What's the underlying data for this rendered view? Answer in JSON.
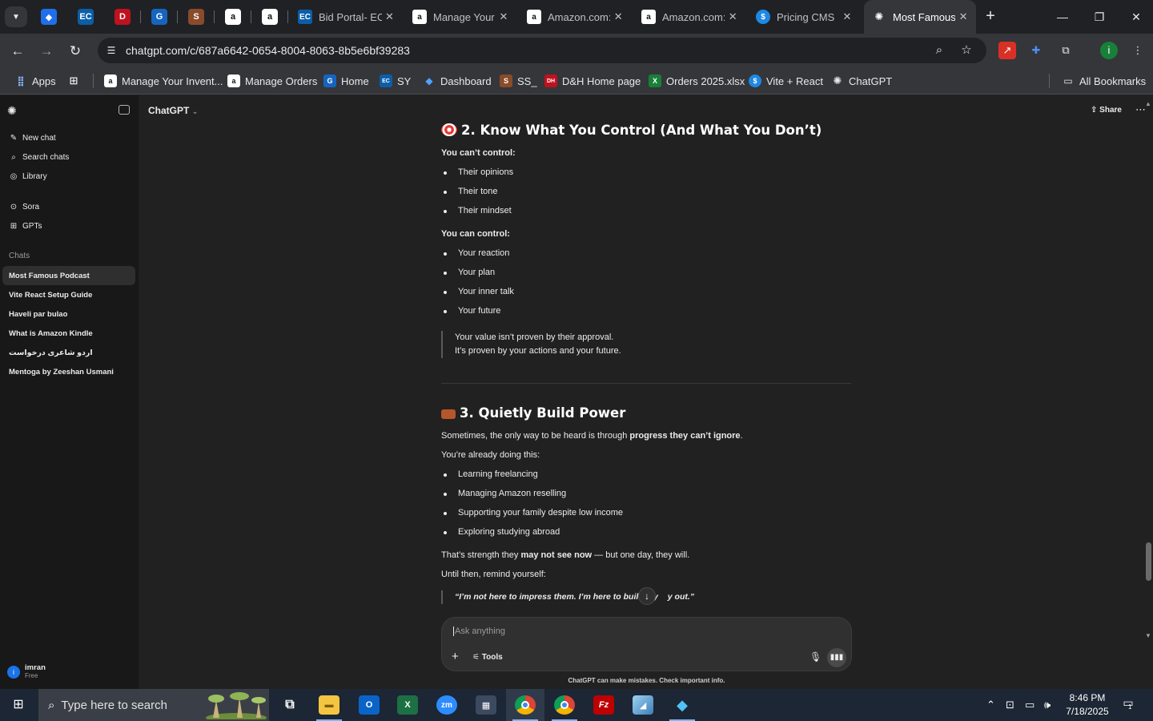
{
  "browser": {
    "tabs": [
      {
        "title": "Bid Portal- EC",
        "favicon": "EC"
      },
      {
        "title": "Manage Your",
        "favicon": "a"
      },
      {
        "title": "Amazon.com:",
        "favicon": "a"
      },
      {
        "title": "Amazon.com:",
        "favicon": "a"
      },
      {
        "title": "Pricing CMS",
        "favicon": "$"
      },
      {
        "title": "Most Famous",
        "favicon": "gpt"
      }
    ],
    "url": "chatgpt.com/c/687a6642-0654-8004-8063-8b5e6bf39283",
    "bookmarks": {
      "apps": "Apps",
      "items": [
        {
          "label": "Manage Your Invent...",
          "icon": "a"
        },
        {
          "label": "Manage Orders",
          "icon": "a"
        },
        {
          "label": "Home",
          "icon": "G"
        },
        {
          "label": "SY",
          "icon": "EC"
        },
        {
          "label": "Dashboard",
          "icon": "◆"
        },
        {
          "label": "SS_",
          "icon": "S"
        },
        {
          "label": "D&H Home page",
          "icon": "DH"
        },
        {
          "label": "Orders 2025.xlsx",
          "icon": "X"
        },
        {
          "label": "Vite + React",
          "icon": "$"
        },
        {
          "label": "ChatGPT",
          "icon": "✺"
        }
      ],
      "all": "All Bookmarks"
    }
  },
  "sidebar": {
    "new_chat": "New chat",
    "search": "Search chats",
    "library": "Library",
    "sora": "Sora",
    "gpts": "GPTs",
    "chats_label": "Chats",
    "chats": [
      "Most Famous Podcast",
      "Vite React Setup Guide",
      "Haveli par bulao",
      "What is Amazon Kindle",
      "اردو شاعری درخواست",
      "Mentoga by Zeeshan Usmani"
    ],
    "user": {
      "name": "imran",
      "plan": "Free",
      "initial": "i"
    }
  },
  "header": {
    "model": "ChatGPT",
    "share": "Share"
  },
  "content": {
    "section2": {
      "title": "2. Know What You Control (And What You Don’t)",
      "cant_label": "You can’t control:",
      "cant": [
        "Their opinions",
        "Their tone",
        "Their mindset"
      ],
      "can_label": "You can control:",
      "can": [
        "Your reaction",
        "Your plan",
        "Your inner talk",
        "Your future"
      ],
      "quote1": "Your value isn’t proven by their approval.",
      "quote2": "It’s proven by your actions and your future."
    },
    "section3": {
      "title": "3. Quietly Build Power",
      "p1_a": "Sometimes, the only way to be heard is through ",
      "p1_b": "progress they can’t ignore",
      "p1_c": ".",
      "p2": "You’re already doing this:",
      "items": [
        "Learning freelancing",
        "Managing Amazon reselling",
        "Supporting your family despite low income",
        "Exploring studying abroad"
      ],
      "p3_a": "That’s strength they ",
      "p3_b": "may not see now",
      "p3_c": " — but one day, they will.",
      "p4": "Until then, remind yourself:",
      "quote_a": "“I’m not here to impress them. I’m here to build my",
      "quote_b": "y out.”"
    }
  },
  "composer": {
    "placeholder": "Ask anything",
    "tools": "Tools",
    "disclaimer": "ChatGPT can make mistakes. Check important info."
  },
  "taskbar": {
    "search_placeholder": "Type here to search",
    "time": "8:46 PM",
    "date": "7/18/2025",
    "notifications": "1"
  }
}
